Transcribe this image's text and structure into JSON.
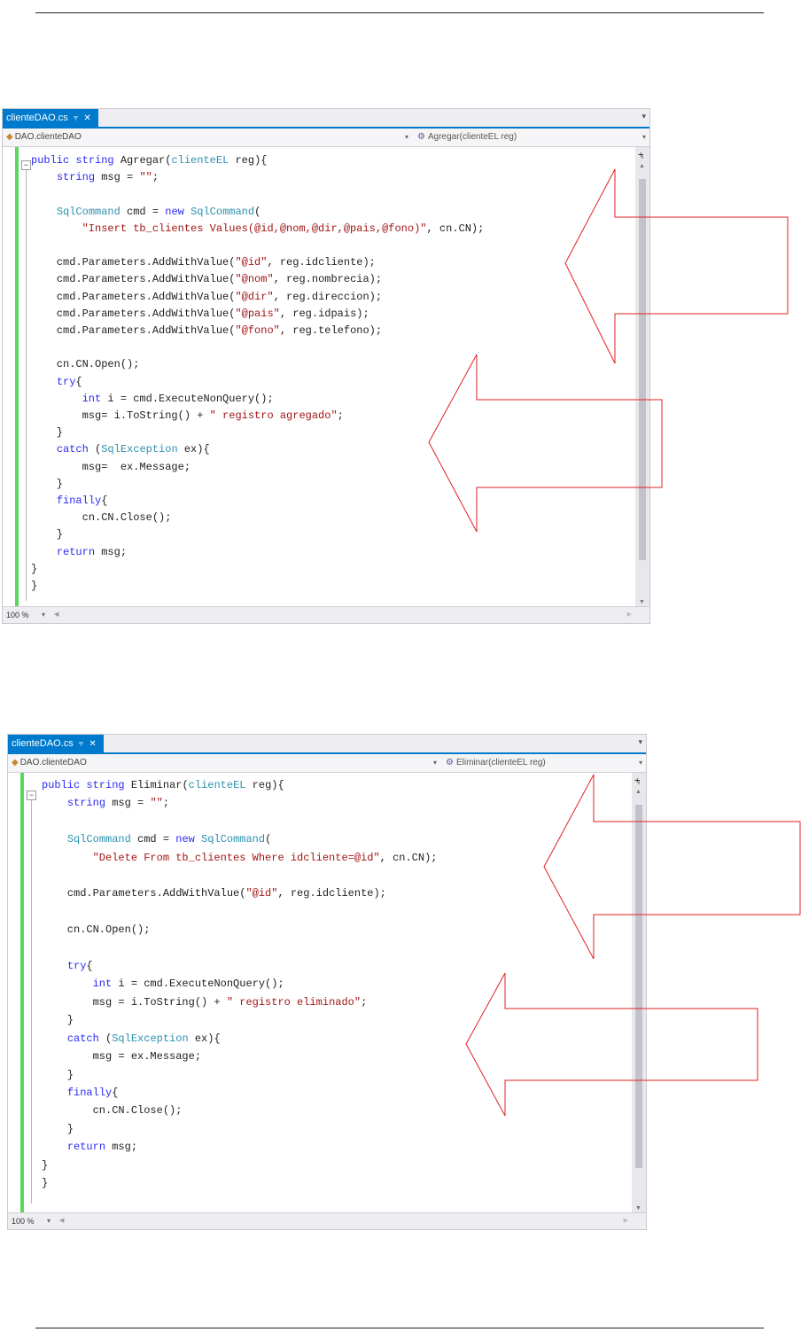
{
  "page": {
    "header_rule": true,
    "footer_rule": true
  },
  "screens": [
    {
      "tab": {
        "title": "clienteDAO.cs",
        "pin_icon": "pin-icon",
        "close_icon": "close-icon"
      },
      "nav": {
        "class_path": "DAO.clienteDAO",
        "member": "Agregar(clienteEL reg)"
      },
      "zoom": "100 %"
    },
    {
      "tab": {
        "title": "clienteDAO.cs",
        "pin_icon": "pin-icon",
        "close_icon": "close-icon"
      },
      "nav": {
        "class_path": "DAO.clienteDAO",
        "member": "Eliminar(clienteEL reg)"
      },
      "zoom": "100 %"
    }
  ],
  "code_agregar": [
    {
      "t": "k",
      "v": "public "
    },
    {
      "t": "k",
      "v": "string"
    },
    {
      "t": "p",
      "v": " Agregar("
    },
    {
      "t": "t",
      "v": "clienteEL"
    },
    {
      "t": "p",
      "v": " reg){\n"
    },
    {
      "t": "p",
      "v": "    "
    },
    {
      "t": "k",
      "v": "string"
    },
    {
      "t": "p",
      "v": " msg = "
    },
    {
      "t": "s",
      "v": "\"\""
    },
    {
      "t": "p",
      "v": ";\n\n"
    },
    {
      "t": "p",
      "v": "    "
    },
    {
      "t": "t",
      "v": "SqlCommand"
    },
    {
      "t": "p",
      "v": " cmd = "
    },
    {
      "t": "k",
      "v": "new"
    },
    {
      "t": "p",
      "v": " "
    },
    {
      "t": "t",
      "v": "SqlCommand"
    },
    {
      "t": "p",
      "v": "(\n"
    },
    {
      "t": "p",
      "v": "        "
    },
    {
      "t": "s",
      "v": "\"Insert tb_clientes Values(@id,@nom,@dir,@pais,@fono)\""
    },
    {
      "t": "p",
      "v": ", cn.CN);\n\n"
    },
    {
      "t": "p",
      "v": "    cmd.Parameters.AddWithValue("
    },
    {
      "t": "s",
      "v": "\"@id\""
    },
    {
      "t": "p",
      "v": ", reg.idcliente);\n"
    },
    {
      "t": "p",
      "v": "    cmd.Parameters.AddWithValue("
    },
    {
      "t": "s",
      "v": "\"@nom\""
    },
    {
      "t": "p",
      "v": ", reg.nombrecia);\n"
    },
    {
      "t": "p",
      "v": "    cmd.Parameters.AddWithValue("
    },
    {
      "t": "s",
      "v": "\"@dir\""
    },
    {
      "t": "p",
      "v": ", reg.direccion);\n"
    },
    {
      "t": "p",
      "v": "    cmd.Parameters.AddWithValue("
    },
    {
      "t": "s",
      "v": "\"@pais\""
    },
    {
      "t": "p",
      "v": ", reg.idpais);\n"
    },
    {
      "t": "p",
      "v": "    cmd.Parameters.AddWithValue("
    },
    {
      "t": "s",
      "v": "\"@fono\""
    },
    {
      "t": "p",
      "v": ", reg.telefono);\n\n"
    },
    {
      "t": "p",
      "v": "    cn.CN.Open();\n"
    },
    {
      "t": "p",
      "v": "    "
    },
    {
      "t": "k",
      "v": "try"
    },
    {
      "t": "p",
      "v": "{\n"
    },
    {
      "t": "p",
      "v": "        "
    },
    {
      "t": "k",
      "v": "int"
    },
    {
      "t": "p",
      "v": " i = cmd.ExecuteNonQuery();\n"
    },
    {
      "t": "p",
      "v": "        msg= i.ToString() + "
    },
    {
      "t": "s",
      "v": "\" registro agregado\""
    },
    {
      "t": "p",
      "v": ";\n"
    },
    {
      "t": "p",
      "v": "    }\n"
    },
    {
      "t": "p",
      "v": "    "
    },
    {
      "t": "k",
      "v": "catch"
    },
    {
      "t": "p",
      "v": " ("
    },
    {
      "t": "t",
      "v": "SqlException"
    },
    {
      "t": "p",
      "v": " ex){\n"
    },
    {
      "t": "p",
      "v": "        msg=  ex.Message;\n"
    },
    {
      "t": "p",
      "v": "    }\n"
    },
    {
      "t": "p",
      "v": "    "
    },
    {
      "t": "k",
      "v": "finally"
    },
    {
      "t": "p",
      "v": "{\n"
    },
    {
      "t": "p",
      "v": "        cn.CN.Close();\n"
    },
    {
      "t": "p",
      "v": "    }\n"
    },
    {
      "t": "p",
      "v": "    "
    },
    {
      "t": "k",
      "v": "return"
    },
    {
      "t": "p",
      "v": " msg;\n"
    },
    {
      "t": "p",
      "v": "}\n"
    },
    {
      "t": "p",
      "v": "}"
    }
  ],
  "code_eliminar": [
    {
      "t": "k",
      "v": "public "
    },
    {
      "t": "k",
      "v": "string"
    },
    {
      "t": "p",
      "v": " Eliminar("
    },
    {
      "t": "t",
      "v": "clienteEL"
    },
    {
      "t": "p",
      "v": " reg){\n"
    },
    {
      "t": "p",
      "v": "    "
    },
    {
      "t": "k",
      "v": "string"
    },
    {
      "t": "p",
      "v": " msg = "
    },
    {
      "t": "s",
      "v": "\"\""
    },
    {
      "t": "p",
      "v": ";\n\n"
    },
    {
      "t": "p",
      "v": "    "
    },
    {
      "t": "t",
      "v": "SqlCommand"
    },
    {
      "t": "p",
      "v": " cmd = "
    },
    {
      "t": "k",
      "v": "new"
    },
    {
      "t": "p",
      "v": " "
    },
    {
      "t": "t",
      "v": "SqlCommand"
    },
    {
      "t": "p",
      "v": "(\n"
    },
    {
      "t": "p",
      "v": "        "
    },
    {
      "t": "s",
      "v": "\"Delete From tb_clientes Where idcliente=@id\""
    },
    {
      "t": "p",
      "v": ", cn.CN);\n\n"
    },
    {
      "t": "p",
      "v": "    cmd.Parameters.AddWithValue("
    },
    {
      "t": "s",
      "v": "\"@id\""
    },
    {
      "t": "p",
      "v": ", reg.idcliente);\n\n"
    },
    {
      "t": "p",
      "v": "    cn.CN.Open();\n\n"
    },
    {
      "t": "p",
      "v": "    "
    },
    {
      "t": "k",
      "v": "try"
    },
    {
      "t": "p",
      "v": "{\n"
    },
    {
      "t": "p",
      "v": "        "
    },
    {
      "t": "k",
      "v": "int"
    },
    {
      "t": "p",
      "v": " i = cmd.ExecuteNonQuery();\n"
    },
    {
      "t": "p",
      "v": "        msg = i.ToString() + "
    },
    {
      "t": "s",
      "v": "\" registro eliminado\""
    },
    {
      "t": "p",
      "v": ";\n"
    },
    {
      "t": "p",
      "v": "    }\n"
    },
    {
      "t": "p",
      "v": "    "
    },
    {
      "t": "k",
      "v": "catch"
    },
    {
      "t": "p",
      "v": " ("
    },
    {
      "t": "t",
      "v": "SqlException"
    },
    {
      "t": "p",
      "v": " ex){\n"
    },
    {
      "t": "p",
      "v": "        msg = ex.Message;\n"
    },
    {
      "t": "p",
      "v": "    }\n"
    },
    {
      "t": "p",
      "v": "    "
    },
    {
      "t": "k",
      "v": "finally"
    },
    {
      "t": "p",
      "v": "{\n"
    },
    {
      "t": "p",
      "v": "        cn.CN.Close();\n"
    },
    {
      "t": "p",
      "v": "    }\n"
    },
    {
      "t": "p",
      "v": "    "
    },
    {
      "t": "k",
      "v": "return"
    },
    {
      "t": "p",
      "v": " msg;\n"
    },
    {
      "t": "p",
      "v": "}\n"
    },
    {
      "t": "p",
      "v": "}"
    }
  ],
  "colors": {
    "keyword": "#2a2af0",
    "type": "#2b91af",
    "string": "#a31515",
    "tab_accent": "#007acc",
    "change_bar": "#5bd85b",
    "callout_arrow": "#e32020"
  },
  "annotations": {
    "arrow_icon": "left-arrow-callout",
    "count": 4
  }
}
